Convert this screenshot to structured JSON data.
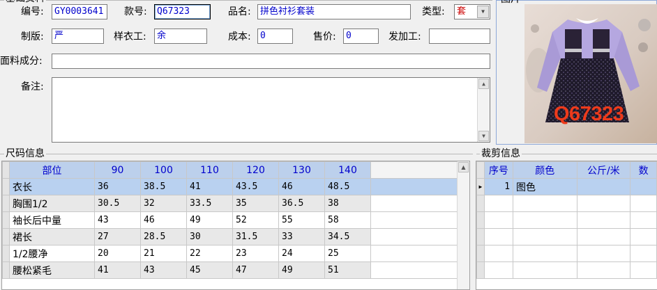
{
  "basic": {
    "section_title": "基础资料",
    "code_label": "编号:",
    "code_value": "GY0003641",
    "style_label": "款号:",
    "style_value": "Q67323",
    "name_label": "品名:",
    "name_value": "拼色衬衫套装",
    "type_label": "类型:",
    "type_value": "套",
    "plate_label": "制版:",
    "plate_value": "严",
    "sample_label": "样衣工:",
    "sample_value": "余",
    "cost_label": "成本:",
    "cost_value": "0",
    "price_label": "售价:",
    "price_value": "0",
    "process_label": "发加工:",
    "process_value": "",
    "fabric_label": "面料成分:",
    "fabric_value": "",
    "remark_label": "备注:",
    "remark_value": ""
  },
  "image_panel": {
    "title": "图片",
    "watermark": "Q67323"
  },
  "size_info": {
    "title": "尺码信息",
    "columns": [
      "部位",
      "90",
      "100",
      "110",
      "120",
      "130",
      "140"
    ],
    "rows": [
      [
        "衣长",
        "36",
        "38.5",
        "41",
        "43.5",
        "46",
        "48.5"
      ],
      [
        "胸围1/2",
        "30.5",
        "32",
        "33.5",
        "35",
        "36.5",
        "38"
      ],
      [
        "袖长后中量",
        "43",
        "46",
        "49",
        "52",
        "55",
        "58"
      ],
      [
        "裙长",
        "27",
        "28.5",
        "30",
        "31.5",
        "33",
        "34.5"
      ],
      [
        "1/2腰净",
        "20",
        "21",
        "22",
        "23",
        "24",
        "25"
      ],
      [
        "腰松紧毛",
        "41",
        "43",
        "45",
        "47",
        "49",
        "51"
      ]
    ]
  },
  "cut_info": {
    "title": "裁剪信息",
    "columns": [
      "序号",
      "颜色",
      "公斤/米",
      "数"
    ],
    "rows": [
      [
        "1",
        "图色",
        "",
        ""
      ]
    ]
  }
}
